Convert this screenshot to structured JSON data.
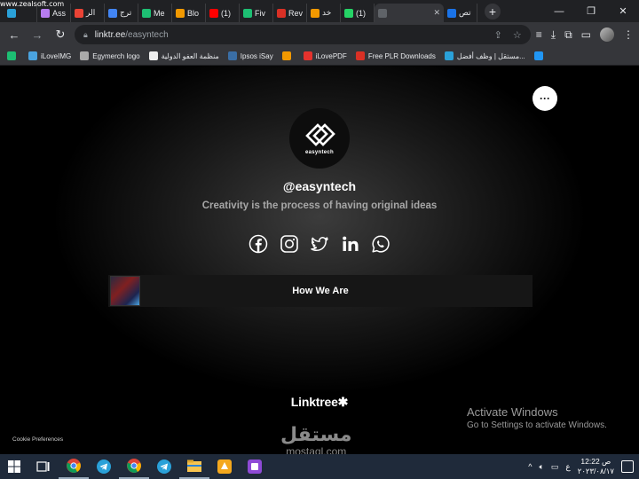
{
  "watermark": "www.zealsoft.com",
  "tabs": [
    {
      "title": "",
      "color": "#2aa1d9"
    },
    {
      "title": "Ass",
      "color": "#b67cf0"
    },
    {
      "title": "الر",
      "color": "#ea4335"
    },
    {
      "title": "ترج",
      "color": "#4285f4"
    },
    {
      "title": "Me",
      "color": "#1dbf73"
    },
    {
      "title": "Blo",
      "color": "#f29900"
    },
    {
      "title": "(1)",
      "color": "#ff0000"
    },
    {
      "title": "Fiv",
      "color": "#1dbf73"
    },
    {
      "title": "Rev",
      "color": "#d93025"
    },
    {
      "title": "خد",
      "color": "#f29900"
    },
    {
      "title": "(1)",
      "color": "#25d366"
    },
    {
      "title": "",
      "color": "#5f6368"
    },
    {
      "title": "تص",
      "color": "#1a73e8"
    }
  ],
  "toolbar": {
    "url_host": "linktr.ee",
    "url_path": "/easyntech"
  },
  "bookmarks": [
    {
      "label": "",
      "color": "#1dbf73"
    },
    {
      "label": "iLoveIMG",
      "color": "#4aa3df"
    },
    {
      "label": "Egymerch logo",
      "color": "#aaaaaa"
    },
    {
      "label": "منظمة العفو الدولية",
      "color": "#eeeeee"
    },
    {
      "label": "Ipsos iSay",
      "color": "#3a6ea5"
    },
    {
      "label": "",
      "color": "#f29900"
    },
    {
      "label": "iLovePDF",
      "color": "#e5322d"
    },
    {
      "label": "Free PLR Downloads",
      "color": "#d93025"
    },
    {
      "label": "مستقل | وظف أفضل...",
      "color": "#2aa1d9"
    },
    {
      "label": "",
      "color": "#2196f3"
    }
  ],
  "profile": {
    "logo_text": "easyntech",
    "handle": "@easyntech",
    "tagline": "Creativity is the process of having original ideas",
    "more_label": "···"
  },
  "socials": [
    "facebook-icon",
    "instagram-icon",
    "twitter-icon",
    "linkedin-icon",
    "whatsapp-icon"
  ],
  "links": [
    {
      "label": "How We Are"
    }
  ],
  "footer": {
    "brand": "Linktree✱",
    "cookie": "Cookie Preferences"
  },
  "overlay": {
    "activate_title": "Activate Windows",
    "activate_sub": "Go to Settings to activate Windows.",
    "mostaql_ar": "مستقل",
    "mostaql_lat": "mostaql.com"
  },
  "taskbar": {
    "apps": [
      "chrome-icon",
      "telegram-icon",
      "chrome-icon",
      "telegram-icon",
      "file-explorer-icon",
      "app-orange-icon",
      "app-purple-icon"
    ],
    "time": "12:22 ص",
    "date": "٢٠٢٣/٠٨/١٧",
    "lang": "ع"
  }
}
